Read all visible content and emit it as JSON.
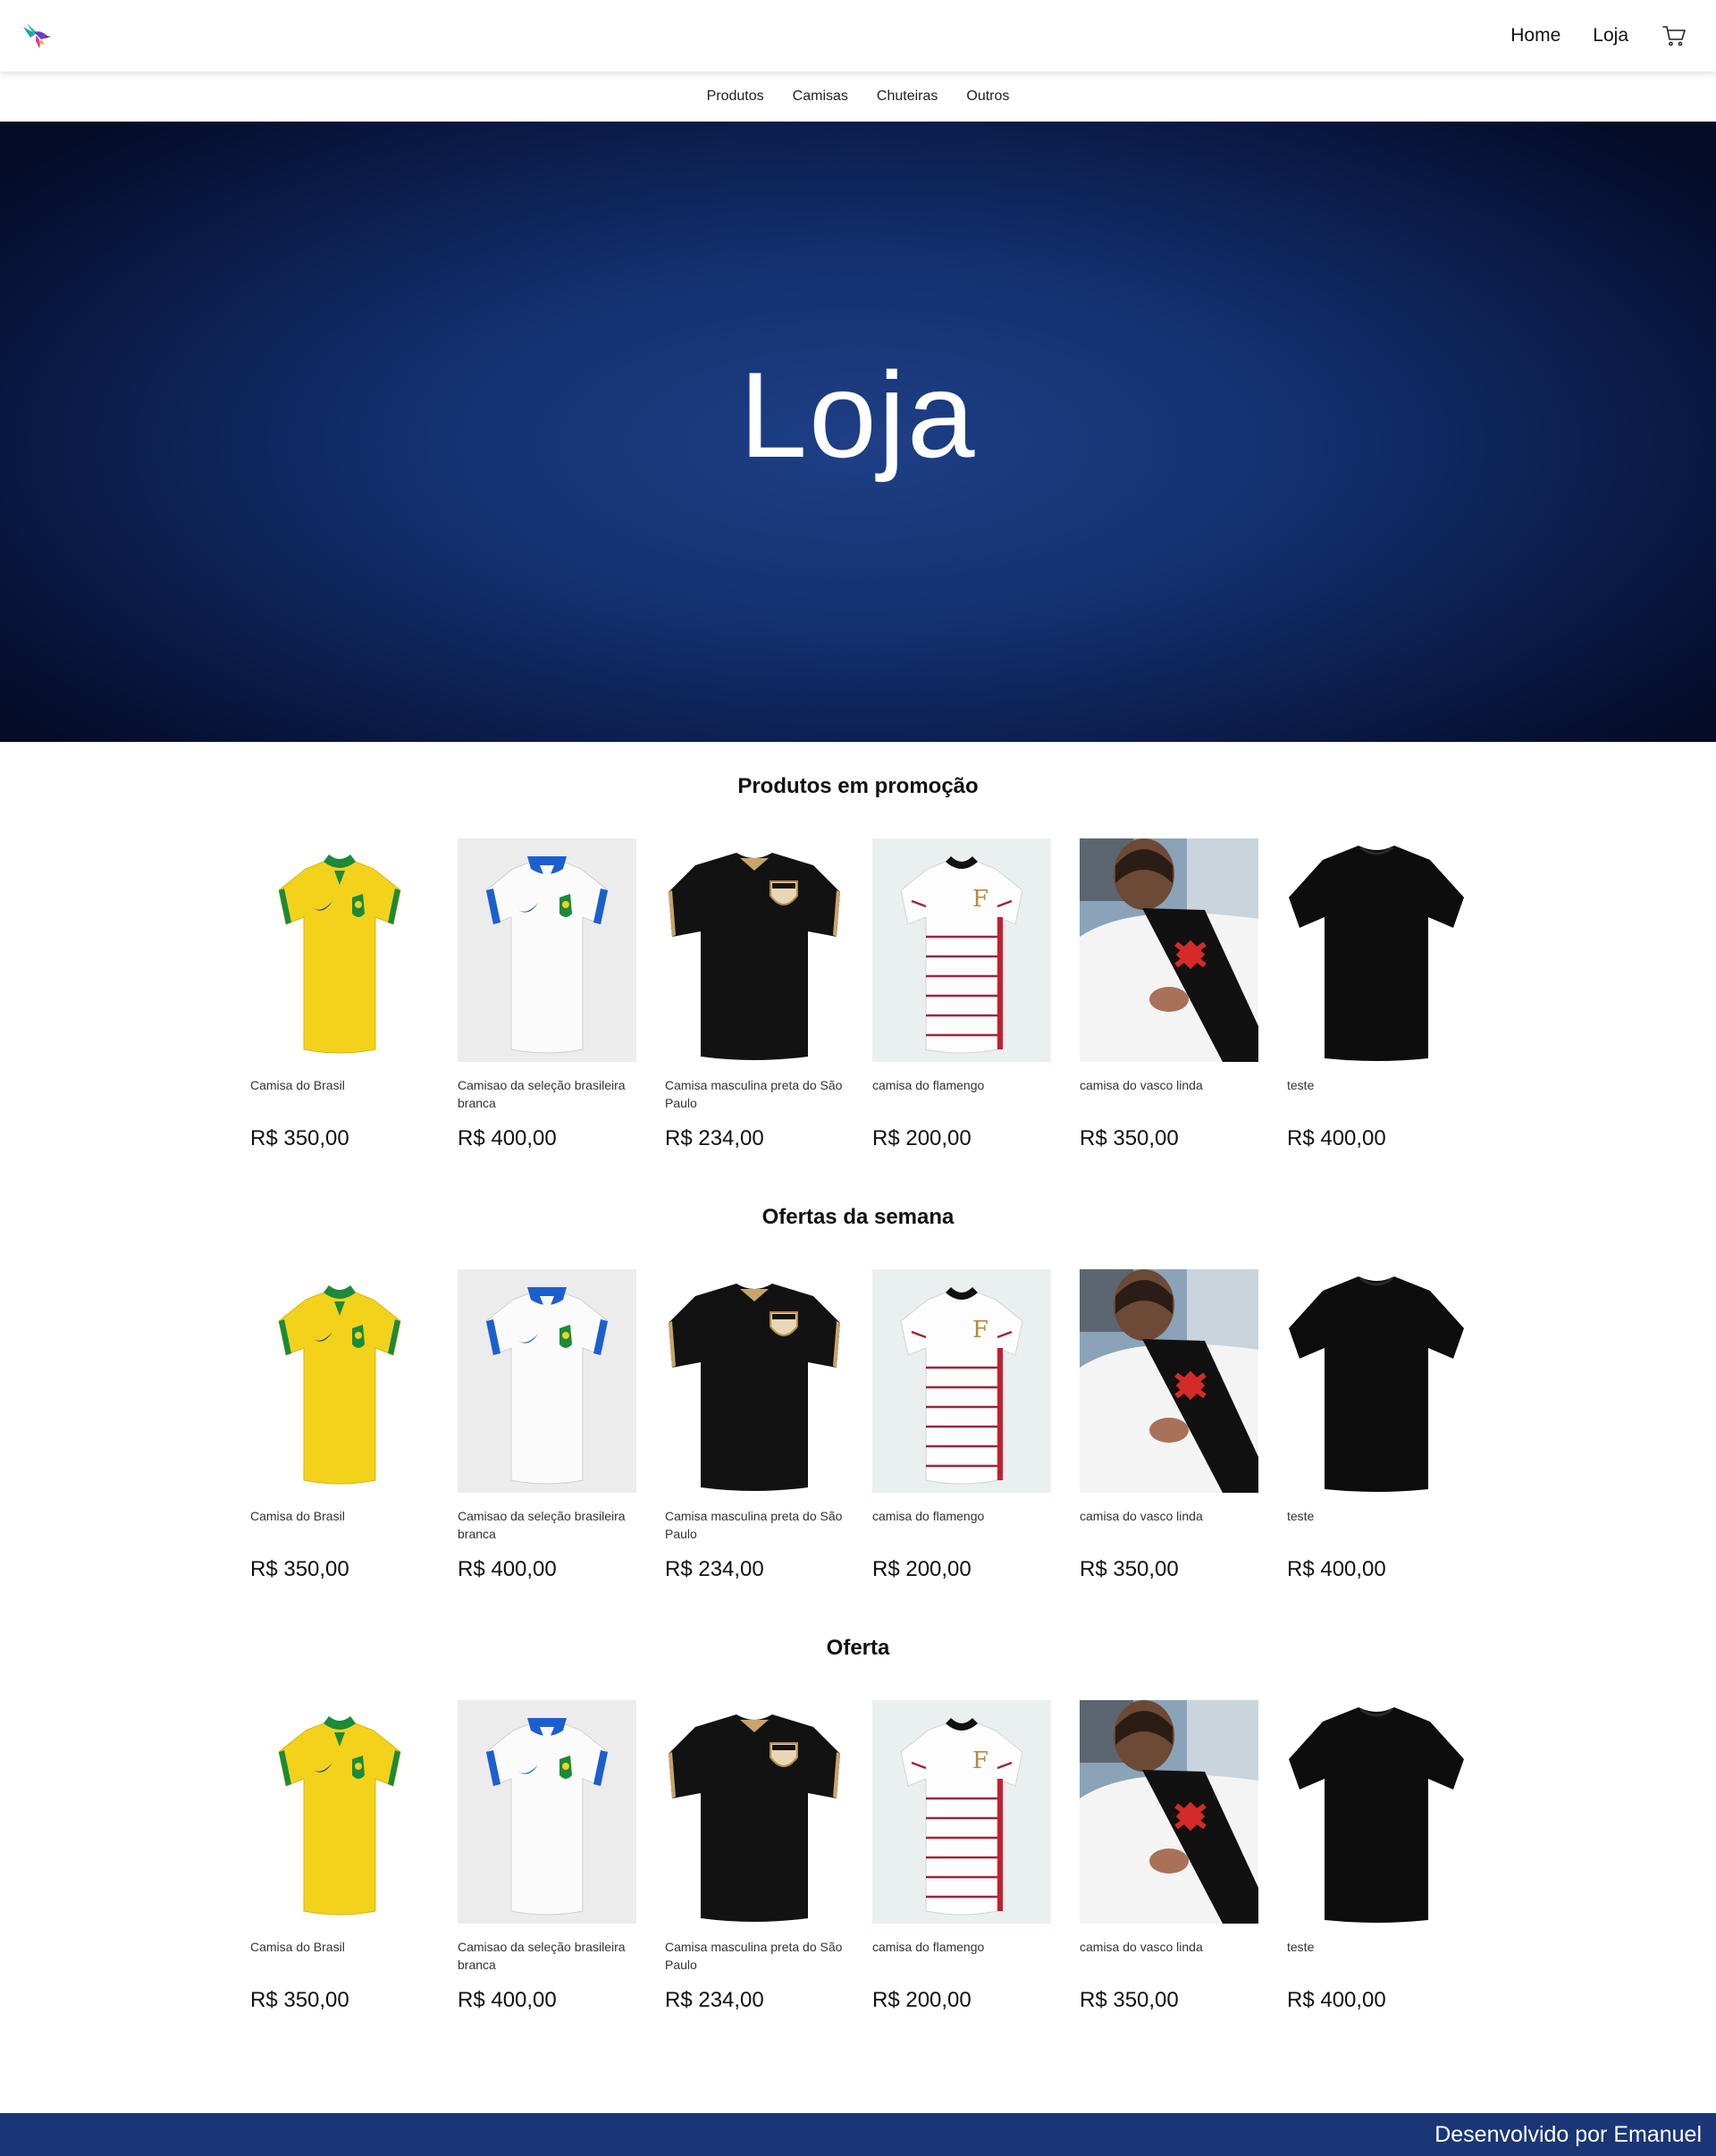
{
  "nav": {
    "home": "Home",
    "store": "Loja",
    "logo_icon": "hummingbird-logo-icon",
    "cart_icon": "cart-icon"
  },
  "categories": [
    "Produtos",
    "Camisas",
    "Chuteiras",
    "Outros"
  ],
  "hero": {
    "title": "Loja"
  },
  "products": [
    {
      "name": "Camisa do Brasil",
      "price": "R$ 350,00",
      "image": "yellow-brazil-jersey"
    },
    {
      "name": "Camisao da seleção brasileira branca",
      "price": "R$ 400,00",
      "image": "white-brazil-jersey"
    },
    {
      "name": "Camisa masculina preta do São Paulo",
      "price": "R$ 234,00",
      "image": "black-sao-paulo-jersey"
    },
    {
      "name": "camisa do flamengo",
      "price": "R$ 200,00",
      "image": "white-striped-flamengo-jersey"
    },
    {
      "name": "camisa do vasco linda",
      "price": "R$ 350,00",
      "image": "vasco-jersey-photo"
    },
    {
      "name": "teste",
      "price": "R$ 400,00",
      "image": "plain-black-tshirt"
    }
  ],
  "sections": [
    {
      "title": "Produtos em promoção"
    },
    {
      "title": "Ofertas da semana"
    },
    {
      "title": "Oferta"
    }
  ],
  "footer": {
    "text": "Desenvolvido por Emanuel"
  },
  "colors": {
    "hero_center": "#1e3f86",
    "hero_edge": "#040c28",
    "footer": "#1b3676"
  }
}
